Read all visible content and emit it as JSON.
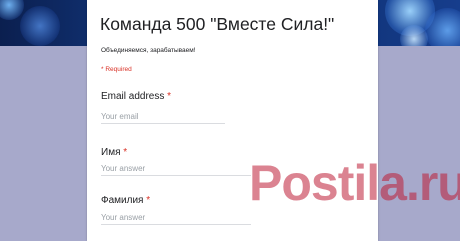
{
  "form": {
    "title": "Команда 500 \"Вместе Сила!\"",
    "description": "Объединяемся, зарабатываем!",
    "required_note": "* Required",
    "questions": [
      {
        "label": "Email address",
        "required_mark": "*",
        "placeholder": "Your email"
      },
      {
        "label": "Имя",
        "required_mark": "*",
        "placeholder": "Your answer"
      },
      {
        "label": "Фамилия",
        "required_mark": "*",
        "placeholder": "Your answer"
      }
    ]
  },
  "watermark": {
    "text": "Postila.ru",
    "color": "#be1e37"
  },
  "colors": {
    "page_background": "#a7a9cb",
    "banner": "#12357a",
    "required": "#d93025"
  }
}
